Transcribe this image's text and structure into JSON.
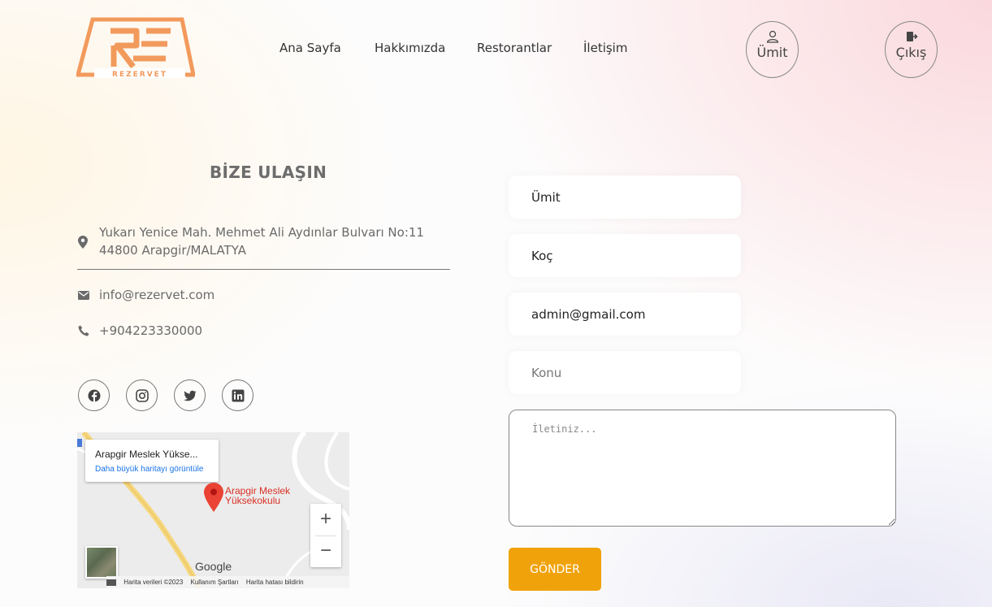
{
  "header": {
    "logo_text": "REZERVET",
    "nav": [
      "Ana Sayfa",
      "Hakkımızda",
      "Restorantlar",
      "İletişim"
    ],
    "user_button": "Ümit",
    "logout_button": "Çıkış"
  },
  "contact": {
    "title": "BİZE ULAŞIN",
    "address_line1": "Yukarı Yenice Mah. Mehmet Ali Aydınlar Bulvarı No:11",
    "address_line2": "44800 Arapgir/MALATYA",
    "email": "info@rezervet.com",
    "phone": "+904223330000",
    "social": [
      "facebook-icon",
      "instagram-icon",
      "twitter-icon",
      "linkedin-icon"
    ]
  },
  "map": {
    "place_name": "Arapgir Meslek Yükse...",
    "larger_map_link": "Daha büyük haritayı görüntüle",
    "pin_label_line1": "Arapgir Meslek",
    "pin_label_line2": "Yüksekokulu",
    "zoom_in": "+",
    "zoom_out": "−",
    "google": "Google",
    "footer_data": "Harita verileri ©2023",
    "footer_terms": "Kullanım Şartları",
    "footer_report": "Harita hatası bildirin"
  },
  "form": {
    "first_name": "Ümit",
    "last_name": "Koç",
    "email": "admin@gmail.com",
    "subject_placeholder": "Konu",
    "message_placeholder": "İletiniz...",
    "submit": "GÖNDER"
  },
  "colors": {
    "logo": "#f29a5c",
    "accent_button": "#f0a20a",
    "link": "#1a73e8",
    "pin": "#d93025"
  }
}
